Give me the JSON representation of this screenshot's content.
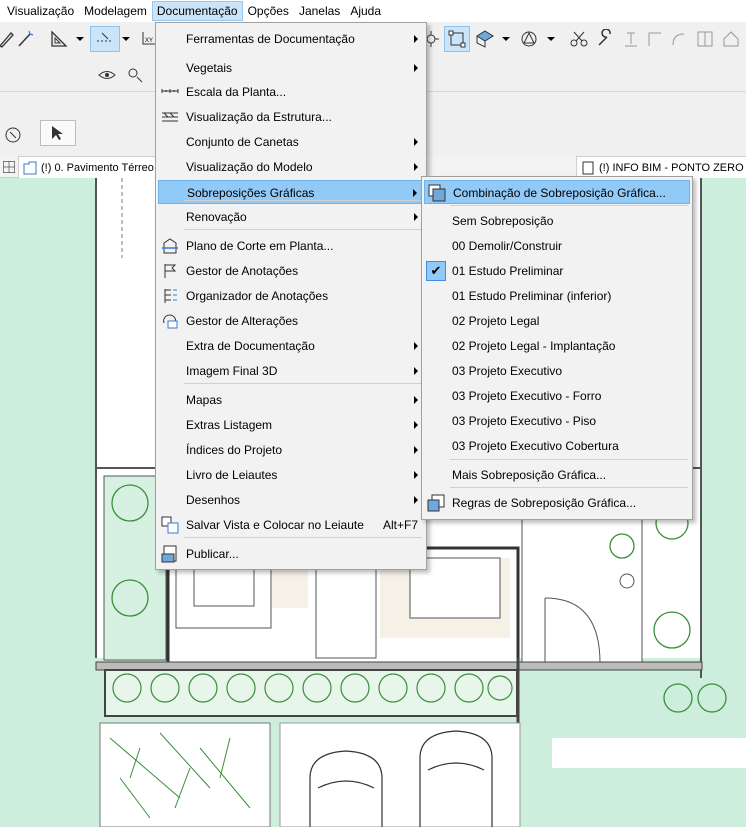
{
  "menubar": {
    "items": [
      "Visualização",
      "Modelagem",
      "Documentação",
      "Opções",
      "Janelas",
      "Ajuda"
    ],
    "active": "Documentação"
  },
  "tabs": {
    "floor_plan": "(!) 0. Pavimento Térreo",
    "bim_view": "(!) INFO BIM - PONTO ZERO ES"
  },
  "documentation_menu": {
    "items": [
      {
        "label": "Ferramentas de Documentação",
        "submenu": true,
        "icon": ""
      },
      {
        "label": "Vegetais",
        "submenu": true,
        "icon": ""
      },
      {
        "label": "Escala da Planta...",
        "submenu": false,
        "icon": "scale-icon"
      },
      {
        "label": "Visualização da Estrutura...",
        "submenu": false,
        "icon": "structure-view-icon"
      },
      {
        "label": "Conjunto de Canetas",
        "submenu": true,
        "icon": ""
      },
      {
        "label": "Visualização do Modelo",
        "submenu": true,
        "icon": ""
      },
      {
        "label": "Sobreposições Gráficas",
        "submenu": true,
        "icon": "",
        "highlighted": true
      },
      {
        "label": "Renovação",
        "submenu": true,
        "icon": ""
      },
      {
        "label": "Plano de Corte em Planta...",
        "submenu": false,
        "icon": "cut-plane-icon"
      },
      {
        "label": "Gestor de Anotações",
        "submenu": false,
        "icon": "flag-icon"
      },
      {
        "label": "Organizador de Anotações",
        "submenu": false,
        "icon": "organizer-icon"
      },
      {
        "label": "Gestor de Alterações",
        "submenu": false,
        "icon": "changes-icon"
      },
      {
        "label": "Extra de Documentação",
        "submenu": true,
        "icon": ""
      },
      {
        "label": "Imagem Final 3D",
        "submenu": true,
        "icon": ""
      },
      {
        "label": "Mapas",
        "submenu": true,
        "icon": ""
      },
      {
        "label": "Extras Listagem",
        "submenu": true,
        "icon": ""
      },
      {
        "label": "Índices do Projeto",
        "submenu": true,
        "icon": ""
      },
      {
        "label": "Livro de Leiautes",
        "submenu": true,
        "icon": ""
      },
      {
        "label": "Desenhos",
        "submenu": true,
        "icon": ""
      },
      {
        "label": "Salvar Vista e Colocar no Leiaute",
        "shortcut": "Alt+F7",
        "submenu": false,
        "icon": "save-view-icon"
      },
      {
        "label": "Publicar...",
        "submenu": false,
        "icon": "publish-icon"
      }
    ]
  },
  "overrides_submenu": {
    "items": [
      {
        "label": "Combinação de Sobreposição Gráfica...",
        "icon": "override-combination-icon",
        "highlighted": true
      },
      {
        "label": "Sem Sobreposição"
      },
      {
        "label": "00 Demolir/Construir"
      },
      {
        "label": "01 Estudo Preliminar",
        "checked": true
      },
      {
        "label": "01 Estudo Preliminar (inferior)"
      },
      {
        "label": "02 Projeto Legal"
      },
      {
        "label": "02 Projeto Legal - Implantação"
      },
      {
        "label": "03 Projeto Executivo"
      },
      {
        "label": "03 Projeto Executivo - Forro"
      },
      {
        "label": "03 Projeto Executivo - Piso"
      },
      {
        "label": "03 Projeto Executivo Cobertura"
      },
      {
        "label": "Mais Sobreposição Gráfica..."
      },
      {
        "label": "Regras de Sobreposição Gráfica...",
        "icon": "override-rules-icon"
      }
    ]
  },
  "colors": {
    "menu_highlight": "#91c9f7",
    "menubar_active": "#cce4f7",
    "canvas_green": "#cdeedd",
    "plant_green": "#3a8f3a"
  }
}
